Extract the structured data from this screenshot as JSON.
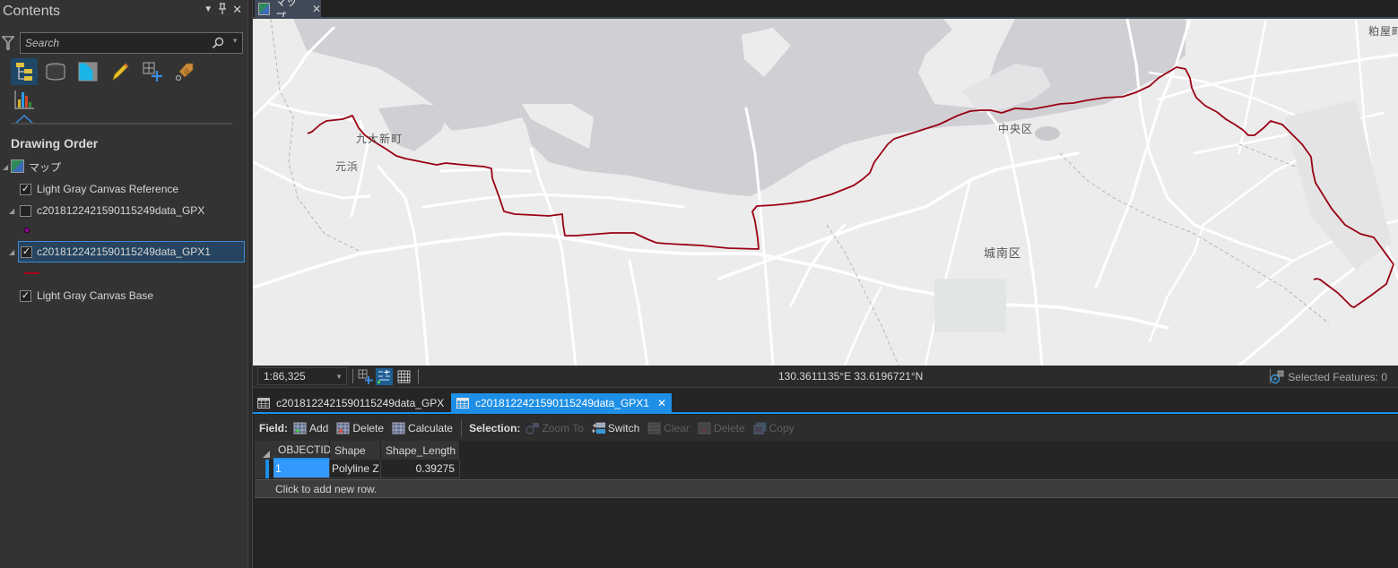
{
  "contents": {
    "title": "Contents",
    "controls": {
      "dropdown": "▾",
      "pin": " ",
      "close": "✕"
    },
    "search": {
      "placeholder": "Search",
      "value": ""
    },
    "tools": [
      {
        "name": "list-by-drawing-order",
        "active": true
      },
      {
        "name": "list-by-source"
      },
      {
        "name": "list-by-selection"
      },
      {
        "name": "list-by-editing"
      },
      {
        "name": "list-by-snapping"
      },
      {
        "name": "list-by-labeling"
      },
      {
        "name": "list-by-charts"
      }
    ],
    "section_title": "Drawing Order",
    "layers": [
      {
        "label": "マップ",
        "type": "map",
        "expanded": true
      },
      {
        "label": "Light Gray Canvas Reference",
        "checked": true
      },
      {
        "label": "c201812242159011524 9data_GPX",
        "checked": false,
        "expanded": true,
        "symbol": "point",
        "symbol_color": "#8b0a8b"
      },
      {
        "label": "c20181224215901152 49data_GPX1",
        "checked": true,
        "expanded": true,
        "selected": true,
        "symbol": "line",
        "symbol_color": "#a8001a"
      },
      {
        "label": "Light Gray Canvas Base",
        "checked": true
      }
    ]
  },
  "map": {
    "tab_label": "マップ",
    "close": "✕",
    "route_color": "#9a0014",
    "water_color": "#d0d0d4",
    "land_color": "#ececec",
    "places": [
      {
        "id": "kyudai",
        "label": "九大新町"
      },
      {
        "id": "motohama",
        "label": "元浜"
      },
      {
        "id": "chuo",
        "label": "中央区"
      },
      {
        "id": "jonan",
        "label": "城南区"
      },
      {
        "id": "kasuya",
        "label": "粕屋町"
      }
    ]
  },
  "status": {
    "scale": "1:86,325",
    "coords": "130.3611135°E 33.6196721°N",
    "selected_features": "Selected Features: 0"
  },
  "table": {
    "tabs": [
      {
        "label": "c20181224215901152 49data_GPX",
        "active": false
      },
      {
        "label": "c20181224215901152 49data_GPX1",
        "active": true,
        "close": "✕"
      }
    ],
    "toolbar": {
      "field_label": "Field:",
      "add": "Add",
      "delete": "Delete",
      "calculate": "Calculate",
      "selection_label": "Selection:",
      "zoom_to": "Zoom To",
      "switch": "Switch",
      "clear": "Clear",
      "sel_delete": "Delete",
      "copy": "Copy"
    },
    "columns": [
      "OBJECTID",
      "Shape",
      "Shape_Length"
    ],
    "rows": [
      {
        "OBJECTID": "1",
        "Shape": "Polyline Z",
        "Shape_Length": "0.39275"
      }
    ],
    "add_row": "Click to add new row."
  }
}
